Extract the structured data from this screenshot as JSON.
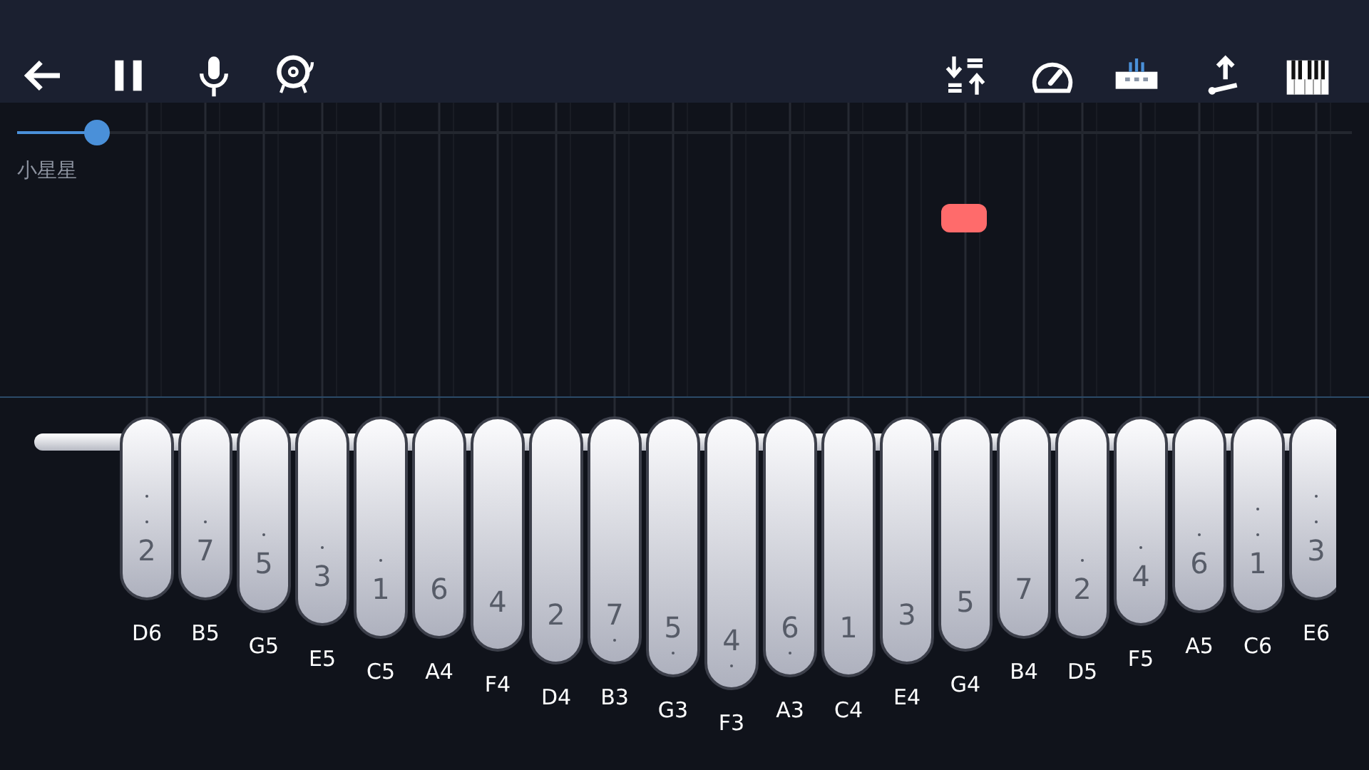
{
  "toolbar": {
    "left": [
      {
        "kind": "back"
      },
      {
        "kind": "pause"
      },
      {
        "kind": "mic"
      },
      {
        "kind": "bell"
      }
    ],
    "right": [
      {
        "kind": "sort"
      },
      {
        "kind": "speed"
      },
      {
        "kind": "kalimba"
      },
      {
        "kind": "transpose"
      },
      {
        "kind": "piano"
      }
    ]
  },
  "progress": {
    "level": 0.06
  },
  "song_title": "小星星",
  "keys": [
    {
      "numeral": "2",
      "note": "D6",
      "kind": "twohigh"
    },
    {
      "numeral": "7",
      "note": "B5",
      "kind": "high"
    },
    {
      "numeral": "5",
      "note": "G5",
      "kind": "high"
    },
    {
      "numeral": "3",
      "note": "E5",
      "kind": "high"
    },
    {
      "numeral": "1",
      "note": "C5",
      "kind": "high"
    },
    {
      "numeral": "6",
      "note": "A4",
      "kind": "middle"
    },
    {
      "numeral": "4",
      "note": "F4",
      "kind": "middle"
    },
    {
      "numeral": "2",
      "note": "D4",
      "kind": "middle"
    },
    {
      "numeral": "7",
      "note": "B3",
      "kind": "low"
    },
    {
      "numeral": "5",
      "note": "G3",
      "kind": "low"
    },
    {
      "numeral": "4",
      "note": "F3",
      "kind": "low"
    },
    {
      "numeral": "6",
      "note": "A3",
      "kind": "low"
    },
    {
      "numeral": "1",
      "note": "C4",
      "kind": "middle"
    },
    {
      "numeral": "3",
      "note": "E4",
      "kind": "middle"
    },
    {
      "numeral": "5",
      "note": "G4",
      "kind": "middle"
    },
    {
      "numeral": "7",
      "note": "B4",
      "kind": "middle"
    },
    {
      "numeral": "2",
      "note": "D5",
      "kind": "high"
    },
    {
      "numeral": "4",
      "note": "F5",
      "kind": "high"
    },
    {
      "numeral": "6",
      "note": "A5",
      "kind": "high"
    },
    {
      "numeral": "1",
      "note": "C6",
      "kind": "twohigh"
    },
    {
      "numeral": "3",
      "note": "E6",
      "kind": "twohigh"
    }
  ]
}
